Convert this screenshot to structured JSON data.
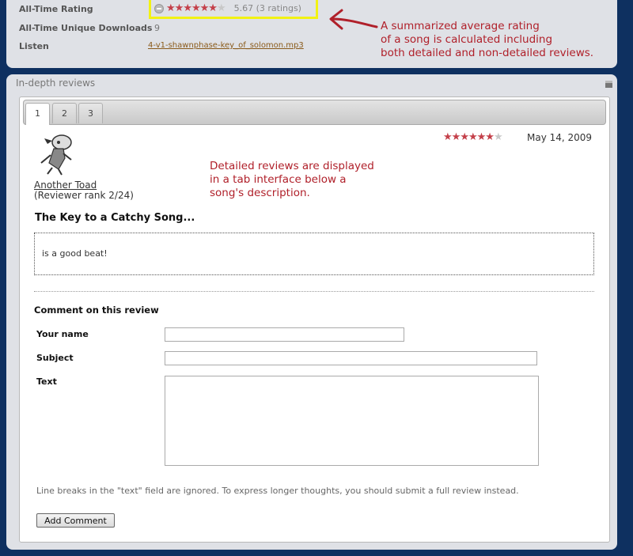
{
  "song_info": {
    "rating_label": "All-Time Rating",
    "rating_value_text": "5.67 (3 ratings)",
    "downloads_label": "All-Time Unique Downloads",
    "downloads_value": "9",
    "listen_label": "Listen",
    "listen_file": "4-v1-shawnphase-key_of_solomon.mp3"
  },
  "annotations": {
    "rating_note": [
      "A summarized average rating",
      "of a song is calculated including",
      "both detailed and non-detailed reviews."
    ],
    "tabs_note": [
      "Detailed reviews are displayed",
      "in a tab interface below a",
      "song's description."
    ]
  },
  "reviews": {
    "panel_title": "In-depth reviews",
    "tabs": [
      {
        "label": "1"
      },
      {
        "label": "2"
      },
      {
        "label": "3"
      }
    ],
    "active_tab": 0,
    "review": {
      "reviewer_name": "Another Toad",
      "reviewer_rank": "(Reviewer rank 2/24)",
      "stars_filled": 6,
      "stars_total": 7,
      "date": "May 14, 2009",
      "title": "The Key to a Catchy Song...",
      "body": "is a good beat!"
    }
  },
  "comment_form": {
    "heading": "Comment on this review",
    "name_label": "Your name",
    "subject_label": "Subject",
    "text_label": "Text",
    "note": "Line breaks in the \"text\" field are ignored.  To express longer thoughts, you should submit a full review instead.",
    "submit_label": "Add Comment"
  },
  "colors": {
    "page_bg": "#0e3060",
    "star_on": "#c4404a",
    "star_off": "#c8c8c8",
    "annotation": "#b0202a",
    "highlight": "#f2f213"
  }
}
